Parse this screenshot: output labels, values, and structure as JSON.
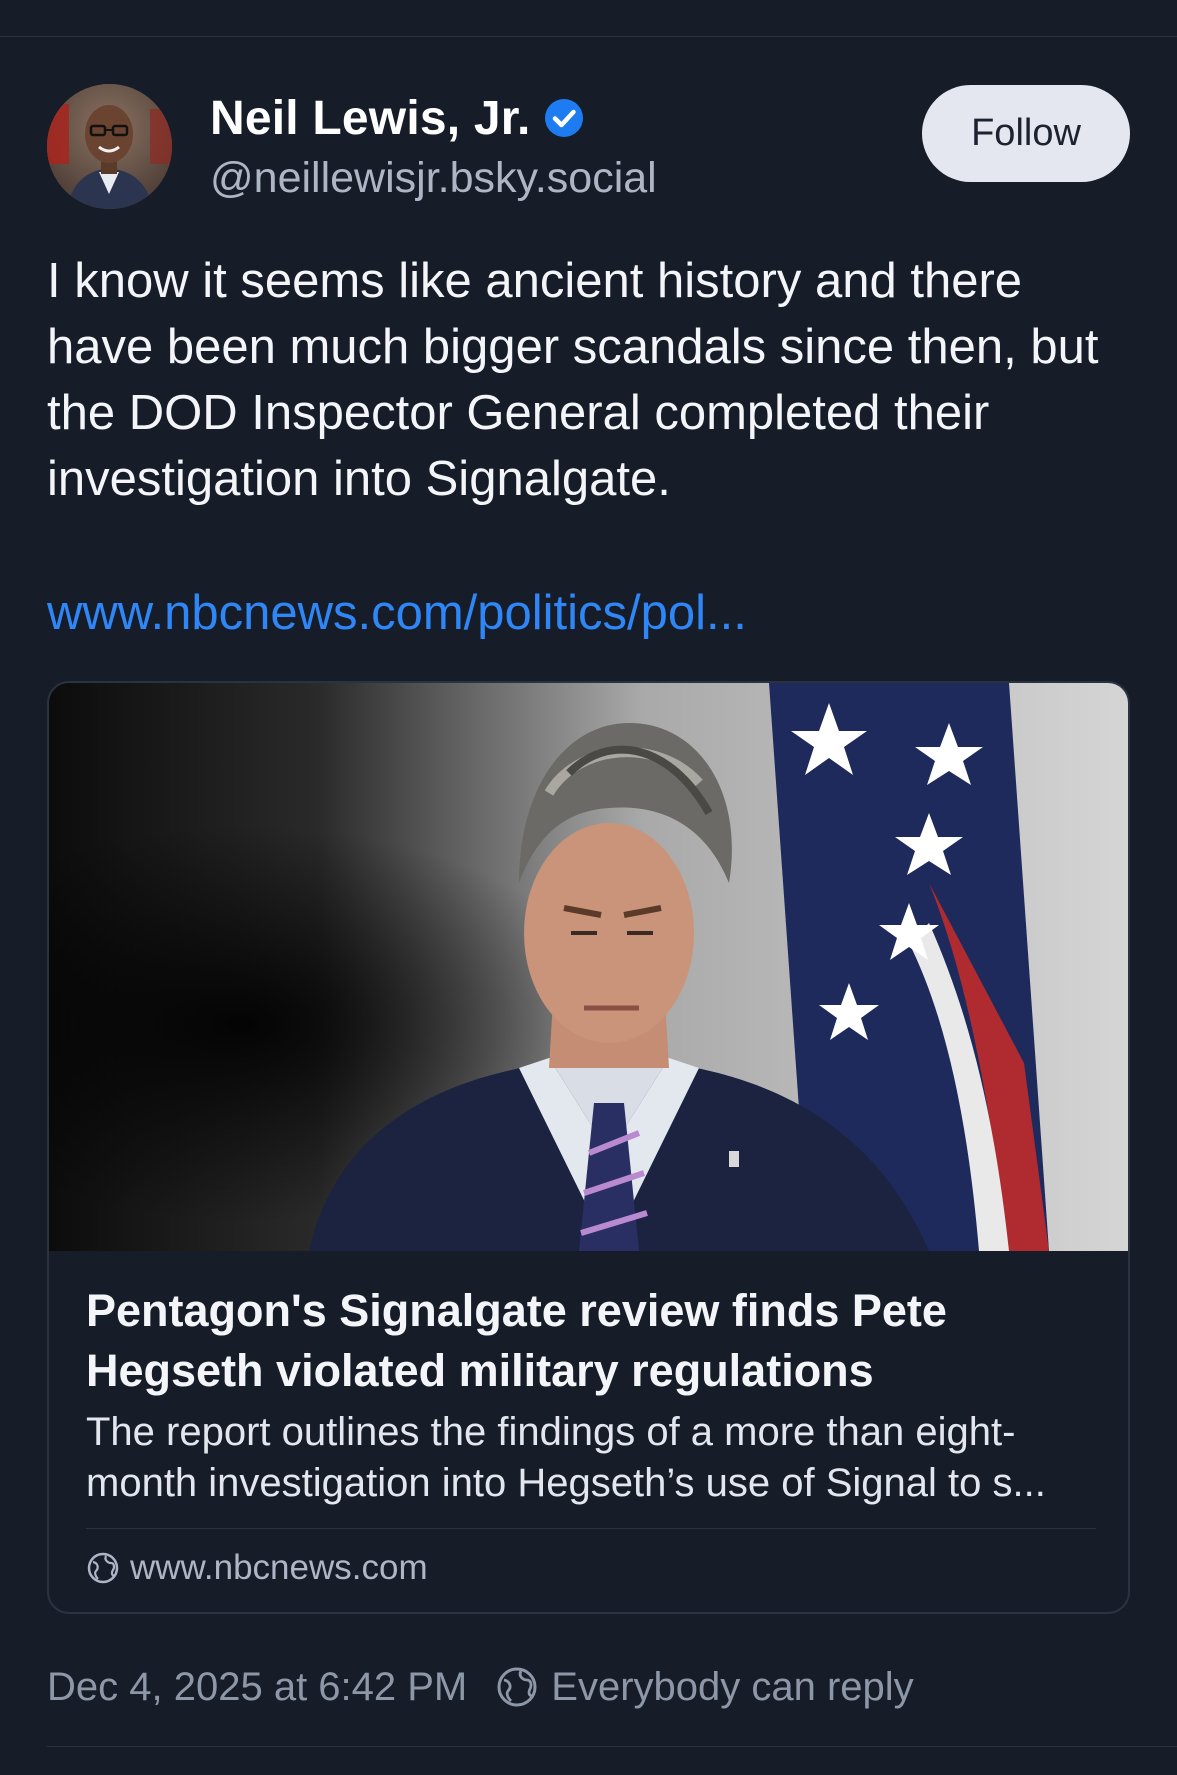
{
  "post": {
    "author": {
      "display_name": "Neil Lewis, Jr.",
      "handle": "@neillewisjr.bsky.social",
      "verified": true
    },
    "follow_label": "Follow",
    "text": "I know it seems like ancient history and there have been much bigger scandals since then, but the DOD Inspector General completed their investigation into Signalgate.",
    "link_text": "www.nbcnews.com/politics/pol...",
    "card": {
      "title": "Pentagon's Signalgate review finds Pete Hegseth violated military regulations",
      "description": "The report outlines the findings of a more than eight-month investigation into Hegseth’s use of Signal to s...",
      "domain": "www.nbcnews.com"
    },
    "timestamp": "Dec 4, 2025 at 6:42 PM",
    "reply_setting": "Everybody can reply"
  },
  "colors": {
    "background": "#171d28",
    "link": "#2f86f6",
    "verified_badge": "#1d7cf2",
    "follow_button": "#e4e7ef",
    "muted_text": "#8e97a8"
  },
  "icons": {
    "verified": "verified-check-icon",
    "globe": "globe-icon"
  }
}
